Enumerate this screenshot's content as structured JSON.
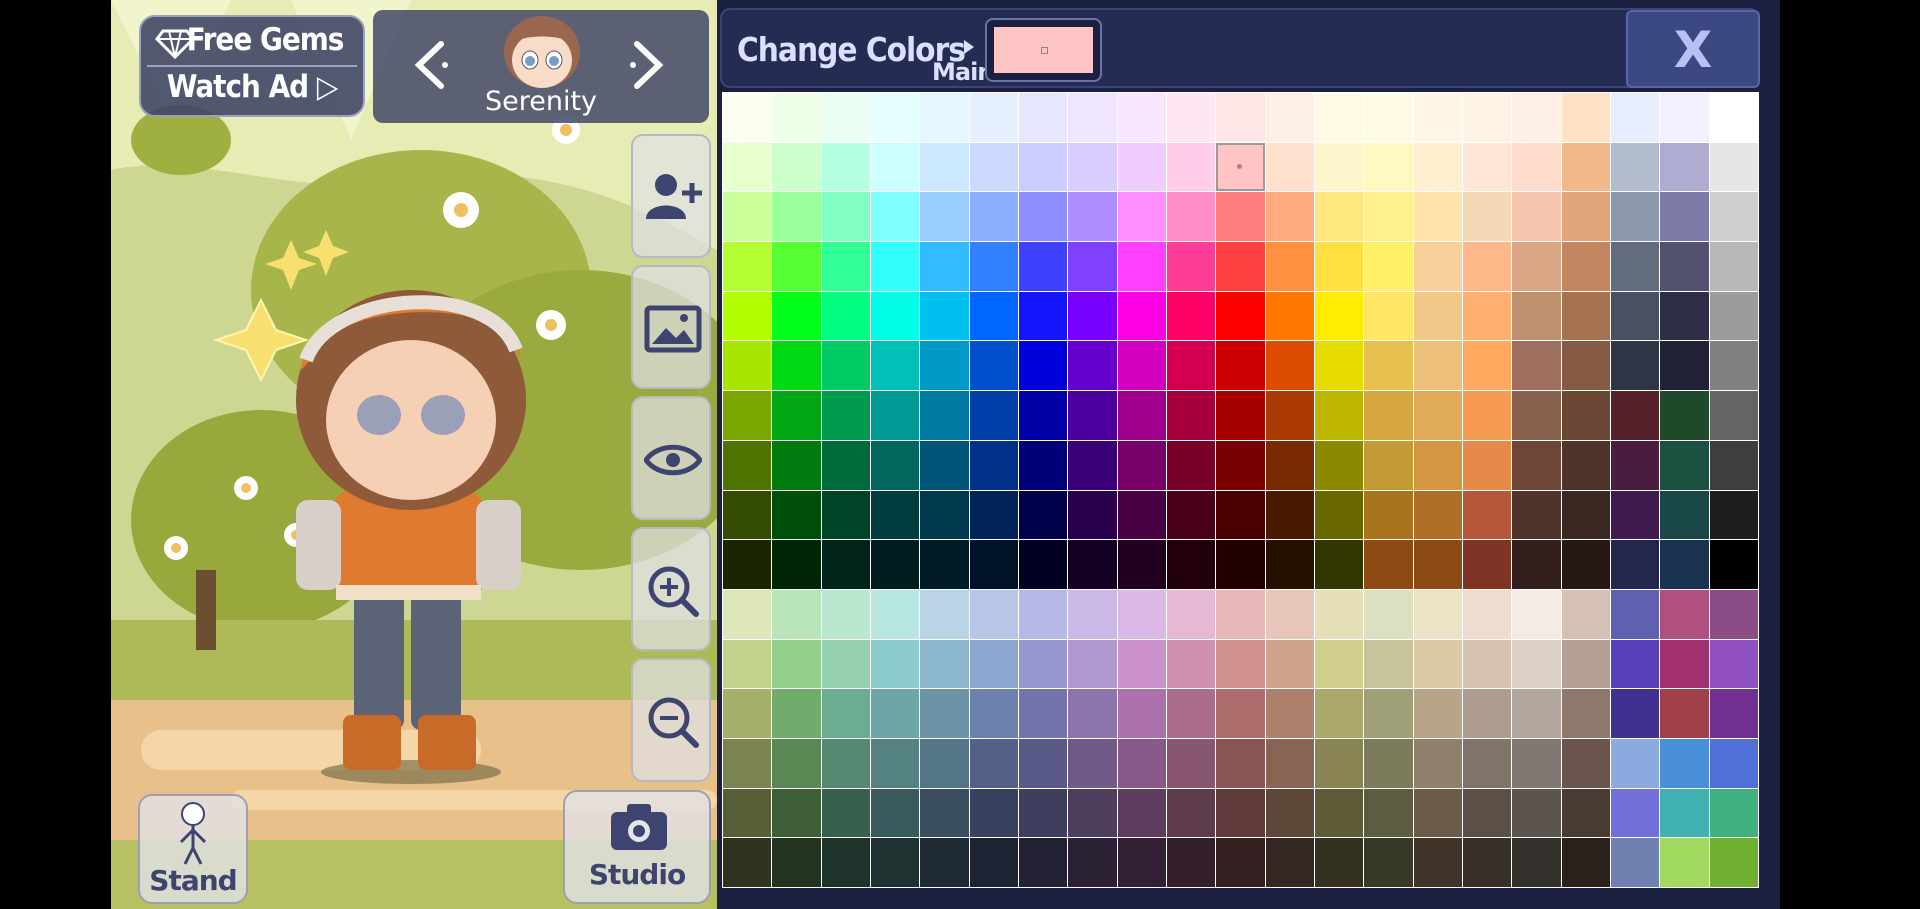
{
  "left_panel": {
    "free_gems_label": "Free Gems",
    "watch_ad_label": "Watch Ad",
    "character_name": "Serenity",
    "stand_label": "Stand",
    "studio_label": "Studio"
  },
  "color_panel": {
    "title": "Change Colors",
    "sublabel": "Main",
    "selected_color": "#ffc5c5",
    "close_label": "X"
  },
  "palette": [
    [
      "#fafff0",
      "#f0ffe8",
      "#ebfff5",
      "#e6ffff",
      "#e6f6ff",
      "#e6f0ff",
      "#e6e6ff",
      "#f0e6ff",
      "#fae6ff",
      "#ffe6f5",
      "#ffe6e6",
      "#fff0e6",
      "#fffae6",
      "#fffbe6",
      "#fff6e6",
      "#fff3e6",
      "#fff0e6",
      "#ffe1c8",
      "#e6edff",
      "#f0f0ff",
      "#ffffff"
    ],
    [
      "#e6ffcc",
      "#ccffcc",
      "#b3ffe0",
      "#ccffff",
      "#cce8ff",
      "#ccd9ff",
      "#ccccff",
      "#d9ccff",
      "#f0ccff",
      "#ffccea",
      "#ffc5c5",
      "#ffe0cc",
      "#fff5cc",
      "#fff8c0",
      "#ffeed0",
      "#ffe6d6",
      "#ffdccc",
      "#f1b88a",
      "#b2bccc",
      "#aeacd0",
      "#e6e6e6"
    ],
    [
      "#ccff99",
      "#99ff99",
      "#80ffc0",
      "#80ffff",
      "#99ccff",
      "#8eaeff",
      "#8e8eff",
      "#b18eff",
      "#ff8eff",
      "#ff8ec8",
      "#ff7e7e",
      "#ffaa80",
      "#ffe780",
      "#fff08e",
      "#ffe4ae",
      "#f5d8b6",
      "#f5c4ac",
      "#e0a57a",
      "#8c99aa",
      "#7c7ca6",
      "#cfcfcf"
    ],
    [
      "#b3ff33",
      "#55ff33",
      "#33ff99",
      "#33ffff",
      "#33bbff",
      "#3380ff",
      "#4040ff",
      "#8040ff",
      "#ff40ff",
      "#ff3d96",
      "#ff4040",
      "#ff9040",
      "#ffe040",
      "#fff066",
      "#f6d29a",
      "#ffb88a",
      "#d8a684",
      "#c38660",
      "#626c7c",
      "#525270",
      "#b8b8b8"
    ],
    [
      "#b3ff00",
      "#00ff19",
      "#00ff80",
      "#00ffe6",
      "#00c0f0",
      "#0066ff",
      "#1414ff",
      "#7700ff",
      "#ff00e6",
      "#ff0066",
      "#ff0000",
      "#ff7700",
      "#ffed00",
      "#ffe666",
      "#f0c888",
      "#ffb070",
      "#bf9070",
      "#a67250",
      "#4a5060",
      "#2e2e48",
      "#9c9c9c"
    ],
    [
      "#a6e600",
      "#00d914",
      "#00cc66",
      "#00c0b8",
      "#009ac6",
      "#0050cc",
      "#0000dc",
      "#6600cc",
      "#d400bf",
      "#d4004f",
      "#cc0000",
      "#dd4c00",
      "#e6dc00",
      "#e8c050",
      "#ecc07a",
      "#ffa860",
      "#9e6e5e",
      "#855a44",
      "#2e3646",
      "#222236",
      "#808080"
    ],
    [
      "#7aa600",
      "#00a614",
      "#009a4c",
      "#009a94",
      "#0078a2",
      "#0040a8",
      "#0000a8",
      "#4d00a0",
      "#a0008c",
      "#a8003c",
      "#a60000",
      "#aa3a00",
      "#bdb600",
      "#d6a640",
      "#e0aa58",
      "#f79a52",
      "#88604e",
      "#6a4634",
      "#56202a",
      "#1f4a2a",
      "#646464"
    ],
    [
      "#4d7300",
      "#007a0e",
      "#006b3a",
      "#00665e",
      "#005478",
      "#003088",
      "#000078",
      "#3a0078",
      "#780068",
      "#780028",
      "#780000",
      "#7a2a00",
      "#8c8800",
      "#c49a34",
      "#d49640",
      "#e58a48",
      "#6e4638",
      "#50342a",
      "#4a1c3e",
      "#1c5040",
      "#3e3e3e"
    ],
    [
      "#334c00",
      "#00500a",
      "#004428",
      "#003c3e",
      "#00384c",
      "#002458",
      "#00004a",
      "#28004c",
      "#4a0044",
      "#4a0018",
      "#4a0000",
      "#4a1a00",
      "#6a6600",
      "#a8741e",
      "#ae6e26",
      "#b6563a",
      "#50342c",
      "#3c2822",
      "#401a4e",
      "#1a4848",
      "#1e1e1e"
    ],
    [
      "#1a2600",
      "#002606",
      "#00241a",
      "#001c1e",
      "#001a26",
      "#001228",
      "#000022",
      "#140022",
      "#220020",
      "#22000c",
      "#220000",
      "#261000",
      "#323600",
      "#8e4a14",
      "#8c4a14",
      "#7e3424",
      "#321e1c",
      "#261814",
      "#24264c",
      "#1a3450",
      "#000000"
    ],
    [
      "#dce6b8",
      "#b8e6b8",
      "#b8e6cf",
      "#b8e6e0",
      "#b8d4e6",
      "#b8c6e6",
      "#b8b8e6",
      "#cab8e6",
      "#dcb8e6",
      "#e6b8d4",
      "#e6b8b8",
      "#e6c6b8",
      "#e6e0b8",
      "#dae0c0",
      "#ece2c6",
      "#eedcce",
      "#f4ece4",
      "#d4c0b4",
      "#6060b0",
      "#b05080",
      "#8c4c88"
    ],
    [
      "#c2d38e",
      "#94d08c",
      "#94d0b0",
      "#8ccccc",
      "#8cb6cc",
      "#8ca6d0",
      "#9898d0",
      "#b298d0",
      "#cc90cc",
      "#d090b0",
      "#d09090",
      "#d0a48c",
      "#d0d08c",
      "#c6c49a",
      "#dccaa6",
      "#d6c2b2",
      "#dcd0c6",
      "#b4a094",
      "#5840b8",
      "#a03070",
      "#9050c0"
    ],
    [
      "#a4b06c",
      "#72ac6c",
      "#6cac90",
      "#6ca6a6",
      "#6c94a6",
      "#6c80ac",
      "#7474ac",
      "#8e74ac",
      "#ac70ac",
      "#ac6c8c",
      "#ac6c6c",
      "#ac806c",
      "#aca86c",
      "#a0a078",
      "#b8a488",
      "#ae9c8e",
      "#b2a69c",
      "#8e786c",
      "#403090",
      "#a04048",
      "#703090"
    ],
    [
      "#7a8450",
      "#5a8854",
      "#548870",
      "#548282",
      "#547488",
      "#546088",
      "#5a5a88",
      "#705a88",
      "#885888",
      "#885670",
      "#885454",
      "#886454",
      "#888454",
      "#7c7c5c",
      "#8e806a",
      "#807468",
      "#827872",
      "#6a544c",
      "#8aaae0",
      "#4a90d8",
      "#5070d8"
    ],
    [
      "#565e38",
      "#3e5e38",
      "#385e4e",
      "#385a5a",
      "#384e5e",
      "#38425e",
      "#3e3e5e",
      "#4e3e5e",
      "#5e3c5e",
      "#5e3c4e",
      "#5e3a3a",
      "#5e4638",
      "#5e5c38",
      "#5c5c40",
      "#6a5c48",
      "#5a5048",
      "#5c544e",
      "#4a3a34",
      "#7070d8",
      "#40b0b0",
      "#40b080"
    ],
    [
      "#30341e",
      "#22341e",
      "#1e342a",
      "#1e3232",
      "#1e2a34",
      "#1e2434",
      "#222234",
      "#2a2234",
      "#342034",
      "#34202a",
      "#342020",
      "#342620",
      "#34321e",
      "#383a28",
      "#3e3428",
      "#363028",
      "#34302c",
      "#2a201c",
      "#7080b0",
      "#a0d860",
      "#70b030"
    ]
  ],
  "selected_cell": {
    "row": 1,
    "col": 10
  }
}
